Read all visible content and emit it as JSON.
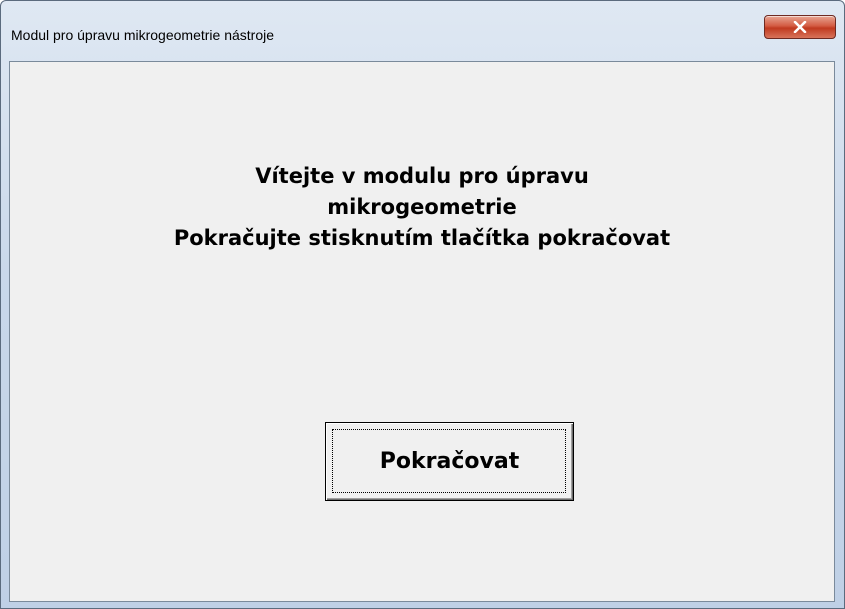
{
  "window": {
    "title": "Modul pro úpravu mikrogeometrie nástroje",
    "close_icon": "close-x-icon",
    "close_color": "#c94a33"
  },
  "message": {
    "line1": "Vítejte v modulu pro úpravu",
    "line2": "mikrogeometrie",
    "line3": "Pokračujte stisknutím tlačítka pokračovat"
  },
  "buttons": {
    "continue_label": "Pokračovat"
  }
}
